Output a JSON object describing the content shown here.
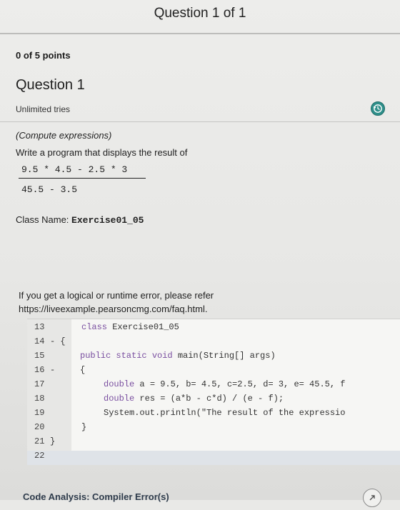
{
  "header": {
    "title": "Question 1 of 1"
  },
  "score": "0 of 5 points",
  "question": {
    "title": "Question 1",
    "tries": "Unlimited tries",
    "topic": "(Compute expressions)",
    "prompt": "Write a program that displays the result of",
    "numerator": "9.5 * 4.5 - 2.5 * 3",
    "denominator": "45.5 - 3.5",
    "class_label": "Class Name:",
    "class_value": "Exercise01_05",
    "error_note_1": "If you get a logical or runtime error, please refer",
    "error_note_2": "https://liveexample.pearsoncmg.com/faq.html."
  },
  "editor": {
    "lines": [
      {
        "num": "13",
        "fold": "",
        "kw": "class",
        "rest": " Exercise01_05"
      },
      {
        "num": "14",
        "fold": "- {",
        "kw": "",
        "rest": ""
      },
      {
        "num": "15",
        "fold": "",
        "kw": "public static void",
        "rest": " main(String[] args)"
      },
      {
        "num": "16",
        "fold": "-",
        "kw": "",
        "rest": "{"
      },
      {
        "num": "17",
        "fold": "",
        "kw": "double",
        "rest": " a = 9.5, b= 4.5, c=2.5, d= 3, e= 45.5, f"
      },
      {
        "num": "18",
        "fold": "",
        "kw": "double",
        "rest": " res = (a*b - c*d) / (e - f);"
      },
      {
        "num": "19",
        "fold": "",
        "kw": "",
        "rest": "System.out.println(\"The result of the expressio"
      },
      {
        "num": "20",
        "fold": "",
        "kw": "",
        "rest": "}"
      },
      {
        "num": "21",
        "fold": "}",
        "kw": "",
        "rest": ""
      },
      {
        "num": "22",
        "fold": "",
        "kw": "",
        "rest": ""
      }
    ]
  },
  "footer": {
    "label": "Code Analysis: Compiler Error(s)"
  },
  "colors": {
    "accent": "#2f8f8a",
    "keyword": "#7a4fa0",
    "number": "#1e63a8"
  },
  "icons": {
    "history": "history-icon",
    "expand": "expand-icon"
  }
}
